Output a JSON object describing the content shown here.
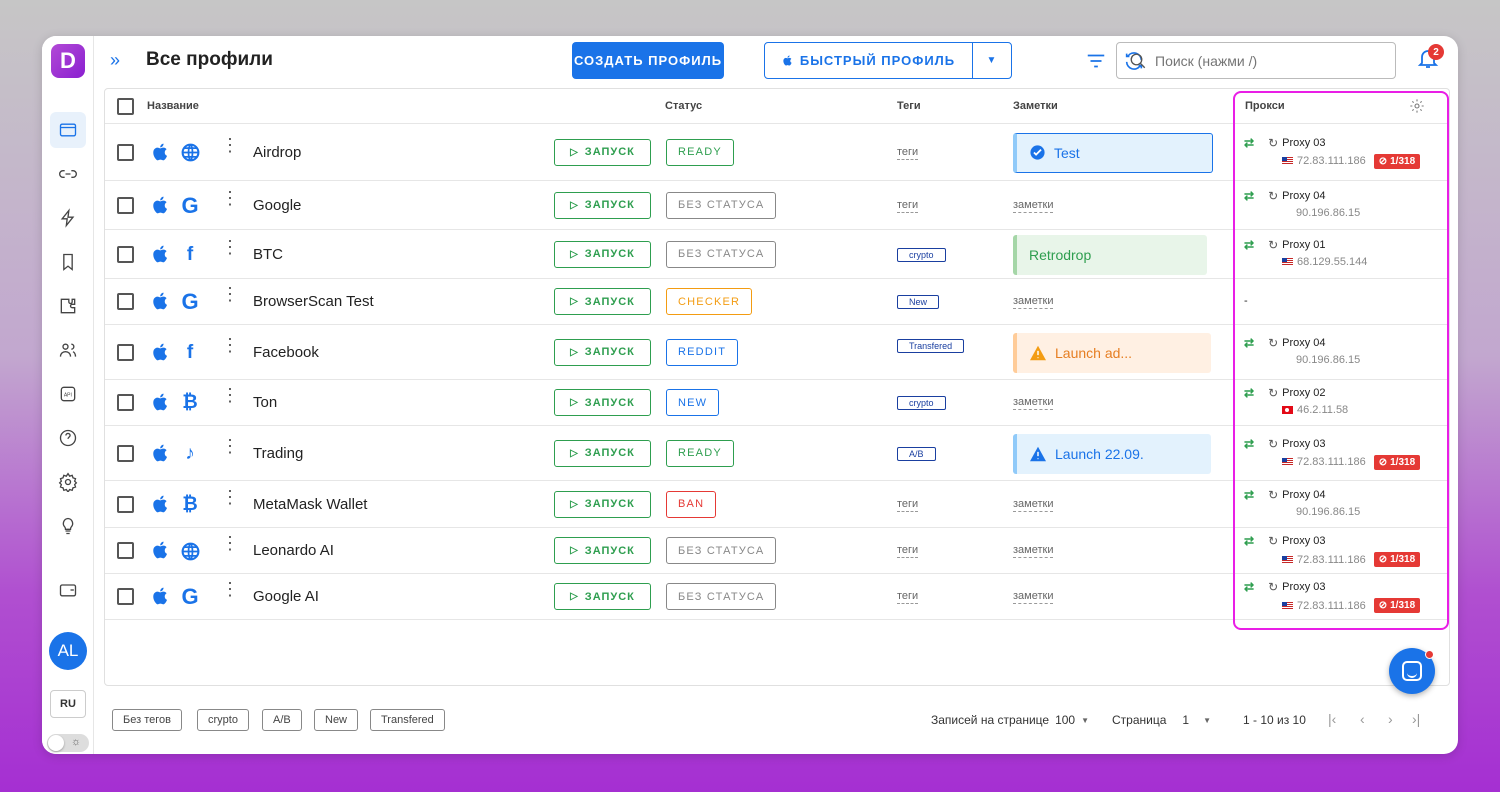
{
  "header": {
    "title": "Все профили",
    "create_label": "СОЗДАТЬ ПРОФИЛЬ",
    "quick_label": "БЫСТРЫЙ ПРОФИЛЬ",
    "search_placeholder": "Поиск (нажми /)",
    "notification_count": "2"
  },
  "sidebar": {
    "logo": "D",
    "avatar": "AL",
    "lang": "RU",
    "items": [
      "profiles-icon",
      "link-icon",
      "automation-icon",
      "bookmarks-icon",
      "extensions-icon",
      "team-icon",
      "api-icon",
      "help-icon",
      "settings-icon",
      "idea-icon",
      "wallet-icon"
    ]
  },
  "columns": {
    "name": "Название",
    "status": "Статус",
    "tags": "Теги",
    "notes": "Заметки",
    "proxy": "Прокси"
  },
  "launch_label": "ЗАПУСК",
  "rows": [
    {
      "name": "Airdrop",
      "brand": "globe-icon",
      "status": "READY",
      "status_color": "#2e9e4f",
      "tag": "теги",
      "tag_type": "empty",
      "note": "Test",
      "note_type": "info",
      "proxy_name": "Proxy 03",
      "proxy_ip": "72.83.111.186",
      "flag": "us",
      "limit": "1/318"
    },
    {
      "name": "Google",
      "brand": "google-icon",
      "status": "БЕЗ СТАТУСА",
      "status_color": "#888888",
      "tag": "теги",
      "tag_type": "empty",
      "note": "заметки",
      "note_type": "empty",
      "proxy_name": "Proxy 04",
      "proxy_ip": "90.196.86.15",
      "flag": "",
      "limit": ""
    },
    {
      "name": "BTC",
      "brand": "facebook-icon",
      "status": "БЕЗ СТАТУСА",
      "status_color": "#888888",
      "tag": "crypto",
      "tag_type": "chip",
      "note": "Retrodrop",
      "note_type": "success",
      "proxy_name": "Proxy 01",
      "proxy_ip": "68.129.55.144",
      "flag": "us",
      "limit": ""
    },
    {
      "name": "BrowserScan Test",
      "brand": "google-icon",
      "status": "CHECKER",
      "status_color": "#f39c12",
      "tag": "New",
      "tag_type": "chip",
      "note": "заметки",
      "note_type": "empty",
      "proxy_name": "",
      "proxy_ip": "",
      "flag": "",
      "limit": "",
      "proxy_empty": "-"
    },
    {
      "name": "Facebook",
      "brand": "facebook-icon",
      "status": "REDDIT",
      "status_color": "#1a73e8",
      "tag": "Transfered",
      "tag_type": "chip",
      "note": "Launch ad...",
      "note_type": "warning",
      "proxy_name": "Proxy 04",
      "proxy_ip": "90.196.86.15",
      "flag": "",
      "limit": ""
    },
    {
      "name": "Ton",
      "brand": "bitcoin-icon",
      "status": "NEW",
      "status_color": "#1a73e8",
      "tag": "crypto",
      "tag_type": "chip",
      "note": "заметки",
      "note_type": "empty",
      "proxy_name": "Proxy 02",
      "proxy_ip": "46.2.11.58",
      "flag": "tr",
      "limit": ""
    },
    {
      "name": "Trading",
      "brand": "tiktok-icon",
      "status": "READY",
      "status_color": "#2e9e4f",
      "tag": "A/B",
      "tag_type": "chip",
      "note": "Launch 22.09.",
      "note_type": "alert",
      "proxy_name": "Proxy 03",
      "proxy_ip": "72.83.111.186",
      "flag": "us",
      "limit": "1/318"
    },
    {
      "name": "MetaMask Wallet",
      "brand": "bitcoin-icon",
      "status": "BAN",
      "status_color": "#e53935",
      "tag": "теги",
      "tag_type": "empty",
      "note": "заметки",
      "note_type": "empty",
      "proxy_name": "Proxy 04",
      "proxy_ip": "90.196.86.15",
      "flag": "",
      "limit": ""
    },
    {
      "name": "Leonardo AI",
      "brand": "globe-icon",
      "status": "БЕЗ СТАТУСА",
      "status_color": "#888888",
      "tag": "теги",
      "tag_type": "empty",
      "note": "заметки",
      "note_type": "empty",
      "proxy_name": "Proxy 03",
      "proxy_ip": "72.83.111.186",
      "flag": "us",
      "limit": "1/318"
    },
    {
      "name": "Google AI",
      "brand": "google-icon",
      "status": "БЕЗ СТАТУСА",
      "status_color": "#888888",
      "tag": "теги",
      "tag_type": "empty",
      "note": "заметки",
      "note_type": "empty",
      "proxy_name": "Proxy 03",
      "proxy_ip": "72.83.111.186",
      "flag": "us",
      "limit": "1/318"
    }
  ],
  "footer": {
    "tags": [
      "Без тегов",
      "crypto",
      "A/B",
      "New",
      "Transfered"
    ],
    "per_page_label": "Записей на странице",
    "per_page_value": "100",
    "page_label": "Страница",
    "page_value": "1",
    "range": "1 - 10 из 10"
  },
  "colors": {
    "accent": "#1a73e8",
    "success": "#2e9e4f",
    "danger": "#e53935",
    "highlight": "#e91ee6"
  }
}
